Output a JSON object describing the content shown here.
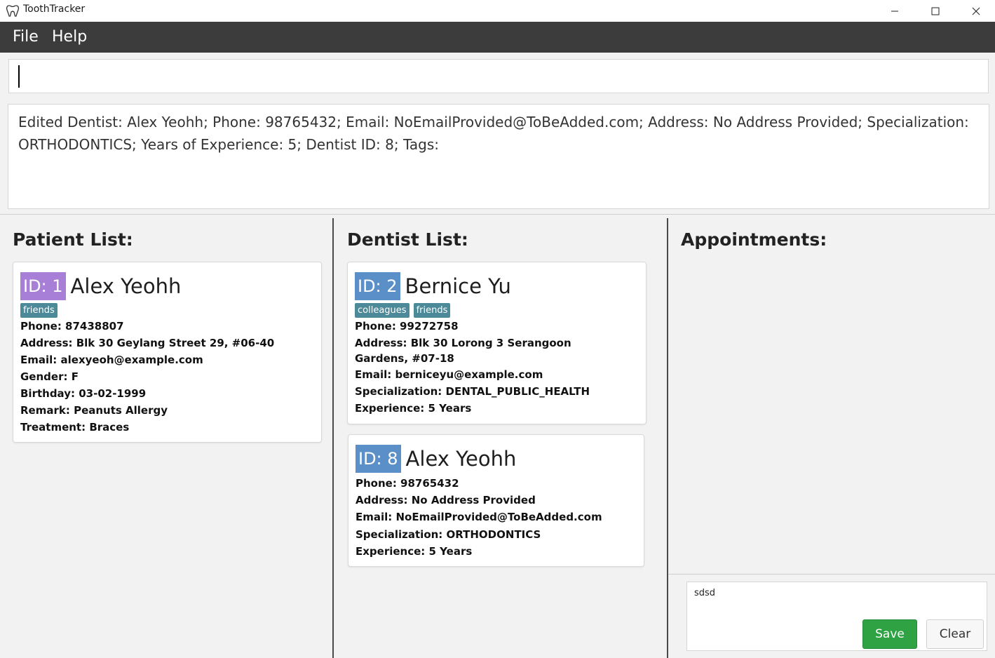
{
  "window": {
    "title": "ToothTracker",
    "icon": "tooth-icon",
    "controls": [
      "minimize-icon",
      "maximize-icon",
      "close-icon"
    ]
  },
  "menu": {
    "file": "File",
    "help": "Help"
  },
  "command": {
    "value": ""
  },
  "result": {
    "text": "Edited Dentist: Alex Yeohh; Phone: 98765432; Email: NoEmailProvided@ToBeAdded.com; Address: No Address Provided; Specialization: ORTHODONTICS; Years of Experience: 5; Dentist ID: 8; Tags:"
  },
  "patients": {
    "title": "Patient List:",
    "items": [
      {
        "id": "ID: 1",
        "name": "Alex Yeohh",
        "tags": [
          "friends"
        ],
        "phone": "Phone: 87438807",
        "address": "Address: Blk 30 Geylang Street 29, #06-40",
        "email": "Email: alexyeoh@example.com",
        "gender": "Gender: F",
        "birthday": "Birthday: 03-02-1999",
        "remark": "Remark: Peanuts Allergy",
        "treatment": "Treatment: Braces"
      }
    ]
  },
  "dentists": {
    "title": "Dentist List:",
    "items": [
      {
        "id": "ID: 2",
        "name": "Bernice Yu",
        "tags": [
          "colleagues",
          "friends"
        ],
        "phone": "Phone: 99272758",
        "address": "Address: Blk 30 Lorong 3 Serangoon Gardens, #07-18",
        "email": "Email: berniceyu@example.com",
        "specialization": "Specialization: DENTAL_PUBLIC_HEALTH",
        "experience": "Experience: 5 Years"
      },
      {
        "id": "ID: 8",
        "name": "Alex Yeohh",
        "tags": [],
        "phone": "Phone: 98765432",
        "address": "Address: No Address Provided",
        "email": "Email: NoEmailProvided@ToBeAdded.com",
        "specialization": "Specialization: ORTHODONTICS",
        "experience": "Experience: 5 Years"
      }
    ]
  },
  "appointments": {
    "title": "Appointments:",
    "input_value": "sdsd",
    "save_label": "Save",
    "clear_label": "Clear"
  },
  "colors": {
    "patient_id_badge": "#a77fd6",
    "dentist_id_badge": "#5b8fc7",
    "tag": "#4d8a99",
    "menubar": "#3c3c3c",
    "save_button": "#2fa344"
  }
}
